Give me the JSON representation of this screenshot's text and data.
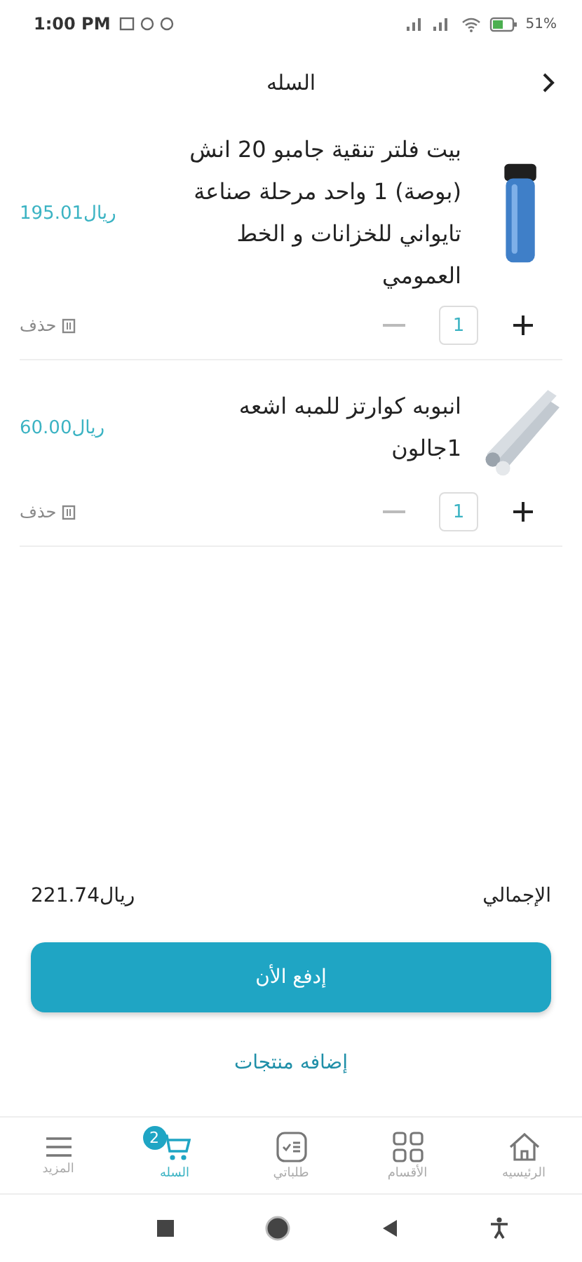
{
  "status_bar": {
    "time": "1:00 PM",
    "battery": "51%"
  },
  "header": {
    "title": "السله"
  },
  "cart_items": [
    {
      "name": "بيت فلتر تنقية جامبو 20 انش (بوصة) 1 واحد مرحلة صناعة تايواني للخزانات و الخط العمومي",
      "price": "195.01ريال",
      "quantity": "1",
      "delete_label": "حذف"
    },
    {
      "name": "انبوبه كوارتز للمبه اشعه 1جالون",
      "price": "60.00ريال",
      "quantity": "1",
      "delete_label": "حذف"
    }
  ],
  "summary": {
    "label": "الإجمالي",
    "total": "221.74ريال"
  },
  "pay_button": "إدفع الأن",
  "add_products_link": "إضافه منتجات",
  "bottom_nav": [
    {
      "kind": "home",
      "label": "الرئيسيه",
      "selected": false
    },
    {
      "kind": "sections",
      "label": "الأقسام",
      "selected": false
    },
    {
      "kind": "orders",
      "label": "طلباتي",
      "selected": false
    },
    {
      "kind": "cart",
      "label": "السله",
      "selected": true,
      "badge": "2"
    },
    {
      "kind": "more",
      "label": "المزيد",
      "selected": false
    }
  ]
}
